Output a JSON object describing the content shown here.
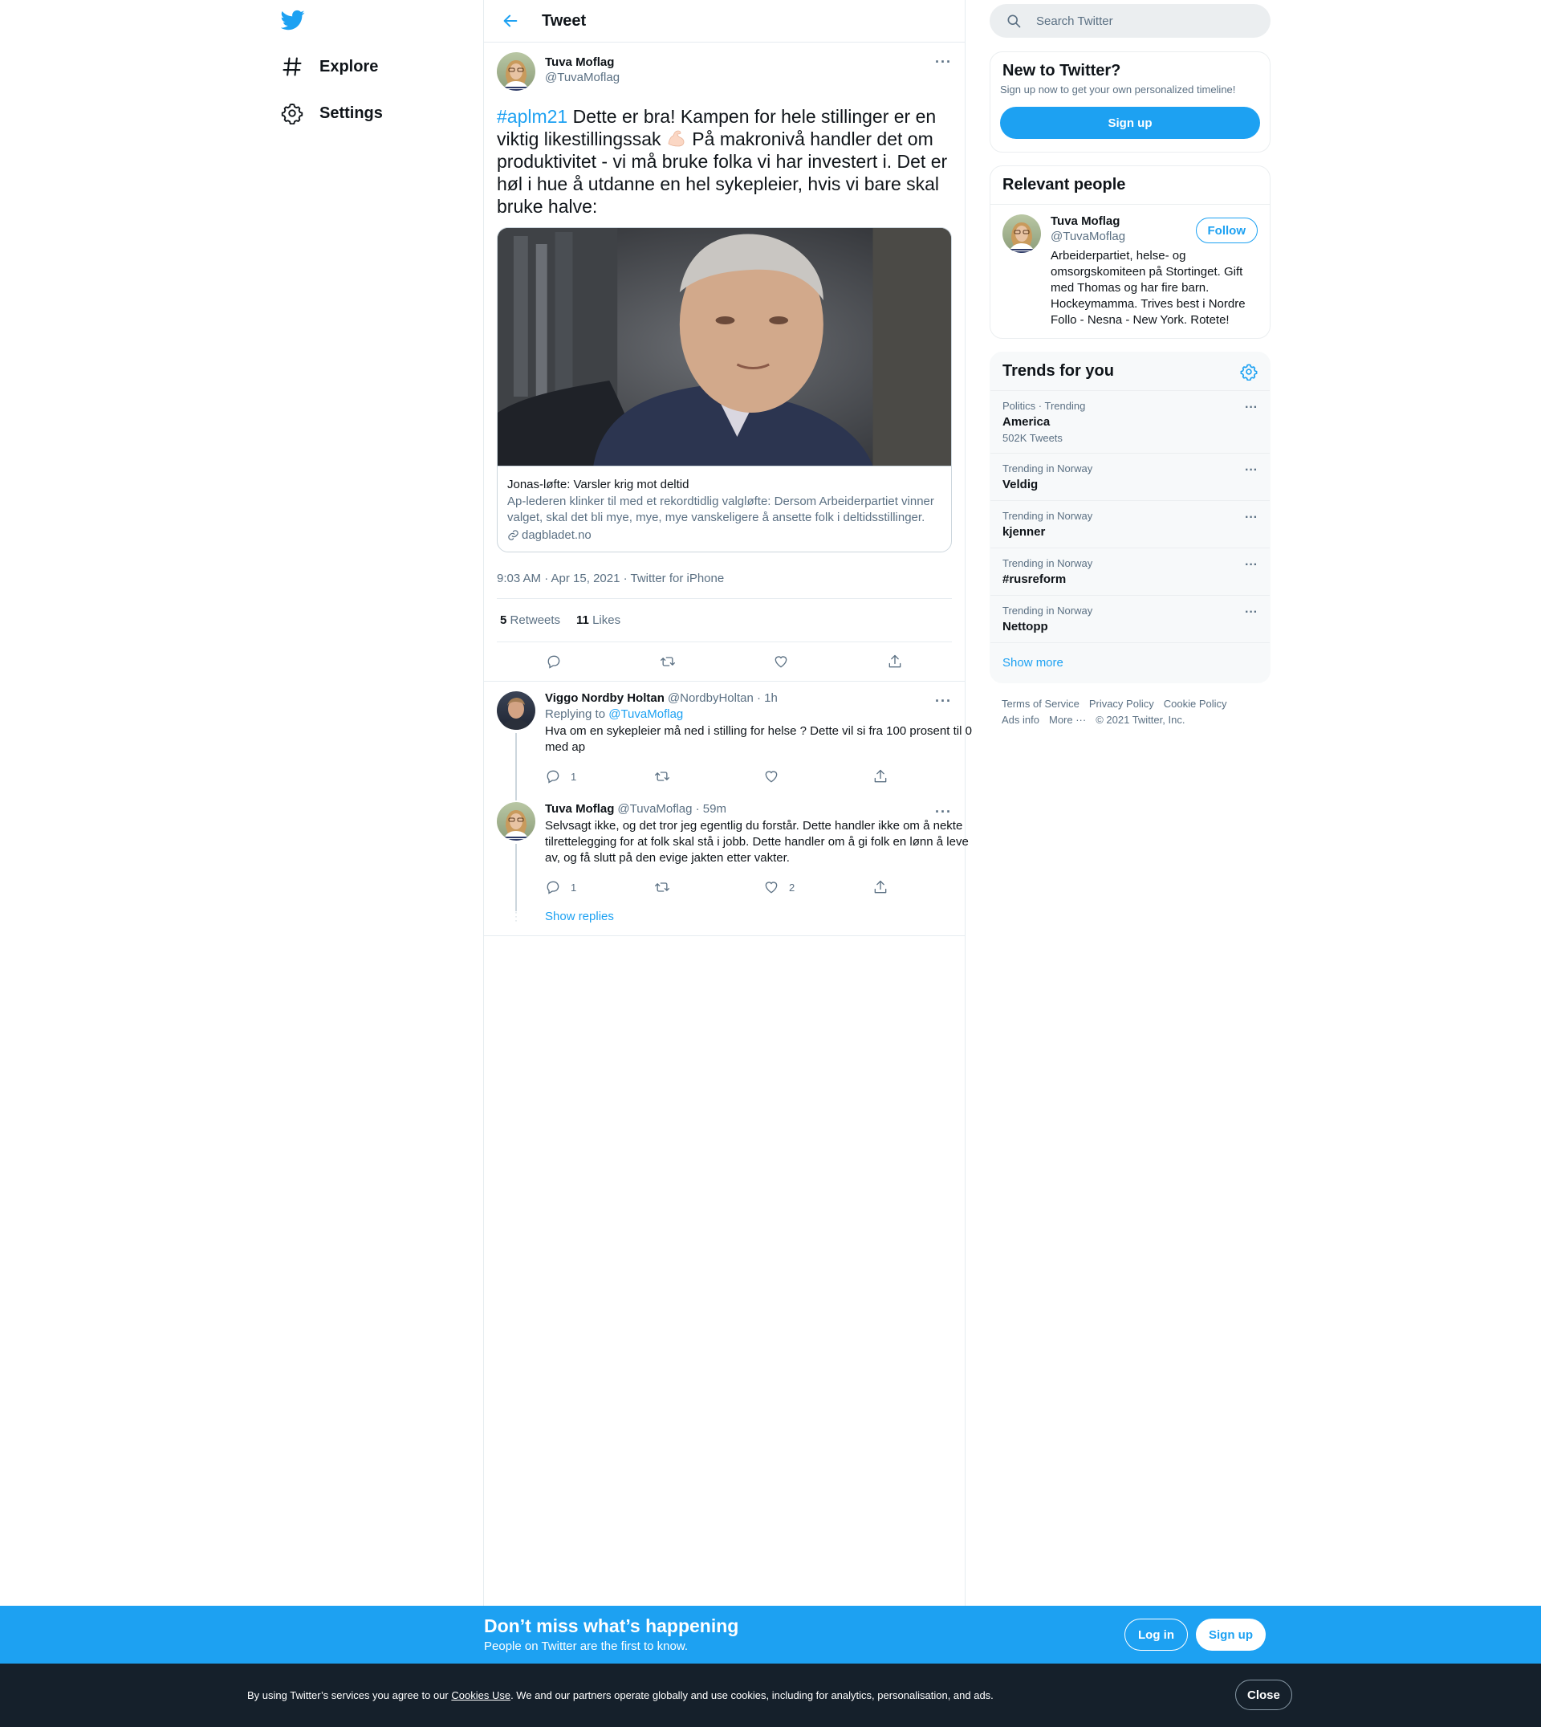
{
  "nav": {
    "items": [
      {
        "label": "Explore",
        "icon": "hashtag-icon"
      },
      {
        "label": "Settings",
        "icon": "gear-icon"
      }
    ]
  },
  "header": {
    "title": "Tweet"
  },
  "tweet": {
    "author_name": "Tuva Moflag",
    "author_handle": "@TuvaMoflag",
    "hashtag": "#aplm21",
    "text_part1": " Dette er bra! Kampen for hele stillinger er en viktig likestillingssak ",
    "text_part2": " På makronivå handler det om produktivitet - vi må bruke folka vi har investert i. Det er høl i hue å utdanne en hel sykepleier, hvis vi bare skal bruke halve:",
    "card": {
      "title": "Jonas-løfte: Varsler krig mot deltid",
      "description": "Ap-lederen klinker til med et rekordtidlig valgløfte: Dersom Arbeiderpartiet vinner valget, skal det bli mye, mye, mye vanskeligere å ansette folk i deltidsstillinger.",
      "domain": "dagbladet.no"
    },
    "timestamp": "9:03 AM · Apr 15, 2021 · Twitter for iPhone",
    "retweets_count": "5",
    "retweets_label": "Retweets",
    "likes_count": "11",
    "likes_label": "Likes"
  },
  "replies": [
    {
      "name": "Viggo Nordby Holtan",
      "meta": "@NordbyHoltan · 1h",
      "replying_prefix": "Replying to ",
      "replying_to": "@TuvaMoflag",
      "text": "Hva om en sykepleier må ned i stilling for helse ? Dette vil si fra 100 prosent til 0 med ap",
      "reply_count": "1",
      "retweet_count": "",
      "like_count": ""
    },
    {
      "name": "Tuva Moflag",
      "meta": "@TuvaMoflag · 59m",
      "text": "Selvsagt ikke, og det tror jeg egentlig du forstår. Dette handler ikke om å nekte tilrettelegging for at folk skal stå i jobb. Dette handler om å gi folk en lønn å leve av, og få slutt på den evige jakten etter vakter.",
      "reply_count": "1",
      "retweet_count": "",
      "like_count": "2"
    }
  ],
  "show_replies_label": "Show replies",
  "search": {
    "placeholder": "Search Twitter"
  },
  "new_to_twitter": {
    "title": "New to Twitter?",
    "subtitle": "Sign up now to get your own personalized timeline!",
    "button": "Sign up"
  },
  "relevant_people": {
    "title": "Relevant people",
    "name": "Tuva Moflag",
    "handle": "@TuvaMoflag",
    "follow_label": "Follow",
    "bio": "Arbeiderpartiet, helse- og omsorgskomiteen på Stortinget. Gift med Thomas og har fire barn. Hockeymamma. Trives best i Nordre Follo - Nesna - New York. Rotete!"
  },
  "trends": {
    "title": "Trends for you",
    "items": [
      {
        "category": "Politics · Trending",
        "name": "America",
        "count": "502K Tweets"
      },
      {
        "category": "Trending in Norway",
        "name": "Veldig",
        "count": ""
      },
      {
        "category": "Trending in Norway",
        "name": "kjenner",
        "count": ""
      },
      {
        "category": "Trending in Norway",
        "name": "#rusreform",
        "count": ""
      },
      {
        "category": "Trending in Norway",
        "name": "Nettopp",
        "count": ""
      }
    ],
    "show_more": "Show more"
  },
  "footer": {
    "links": [
      "Terms of Service",
      "Privacy Policy",
      "Cookie Policy",
      "Ads info",
      "More ···"
    ],
    "copyright": "© 2021 Twitter, Inc."
  },
  "banner": {
    "headline": "Don’t miss what’s happening",
    "sub": "People on Twitter are the first to know.",
    "login": "Log in",
    "signup": "Sign up"
  },
  "cookie": {
    "prefix": "By using Twitter’s services you agree to our ",
    "link": "Cookies Use",
    "suffix": ". We and our partners operate globally and use cookies, including for analytics, personalisation, and ads.",
    "close": "Close"
  },
  "colors": {
    "accent": "#1da1f2",
    "muted": "#5b7083",
    "cookie_bg": "#15202b"
  }
}
